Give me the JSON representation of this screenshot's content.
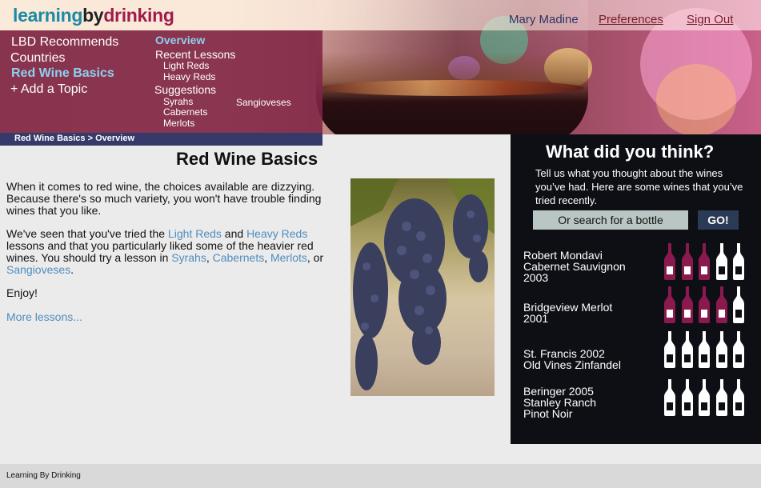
{
  "header": {
    "logo": {
      "part1": "learning",
      "part2": "by",
      "part3": "drinking"
    },
    "user_name": "Mary Madine",
    "preferences_label": "Preferences",
    "signout_label": "Sign Out"
  },
  "menu": {
    "main": [
      "LBD Recommends",
      "Countries",
      "Red Wine Basics",
      "+ Add a Topic"
    ],
    "active_main": "Red Wine Basics",
    "sub": {
      "overview": "Overview",
      "recent_lessons": "Recent Lessons",
      "recent_items": [
        "Light Reds",
        "Heavy Reds"
      ],
      "suggestions": "Suggestions",
      "suggestion_items": [
        "Syrahs",
        "Cabernets",
        "Merlots",
        "Sangioveses"
      ]
    }
  },
  "breadcrumb": "Red Wine Basics > Overview",
  "main": {
    "title": "Red Wine Basics",
    "para1": "When it comes to red wine, the choices available are dizzying. Because there's so much variety, you won't have trouble finding wines that you like.",
    "para2": {
      "t1": "We've seen that you've tried the ",
      "l1": "Light Reds",
      "t2": " and ",
      "l2": "Heavy Reds",
      "t3": " lessons and that you particularly liked some of the heavier red wines. You should try a lesson in ",
      "l3": "Syrahs",
      "t4": ", ",
      "l4": "Cabernets",
      "t5": ", ",
      "l5": "Merlots",
      "t6": ", or ",
      "l6": "Sangioveses",
      "t7": "."
    },
    "para3": "Enjoy!",
    "more_lessons": "More lessons..."
  },
  "sidebar": {
    "title": "What did you think?",
    "text": "Tell us what you thought about the wines you’ve had. Here are some wines that you’ve tried recently.",
    "search_placeholder": "Or search for a bottle",
    "go_label": "GO!",
    "wines": [
      {
        "name": "Robert Mondavi\nCabernet Sauvignon\n2003",
        "rating": 3,
        "max": 5
      },
      {
        "name": "Bridgeview Merlot\n2001",
        "rating": 4,
        "max": 5
      },
      {
        "name": "St. Francis 2002\nOld Vines Zinfandel",
        "rating": 0,
        "max": 5
      },
      {
        "name": "Beringer 2005\nStanley Ranch\nPinot Noir",
        "rating": 0,
        "max": 5
      }
    ],
    "filled_bottle_color": "#8a1a4e",
    "empty_bottle_color": "#ffffff"
  },
  "footer": {
    "text": "Learning By Drinking"
  }
}
